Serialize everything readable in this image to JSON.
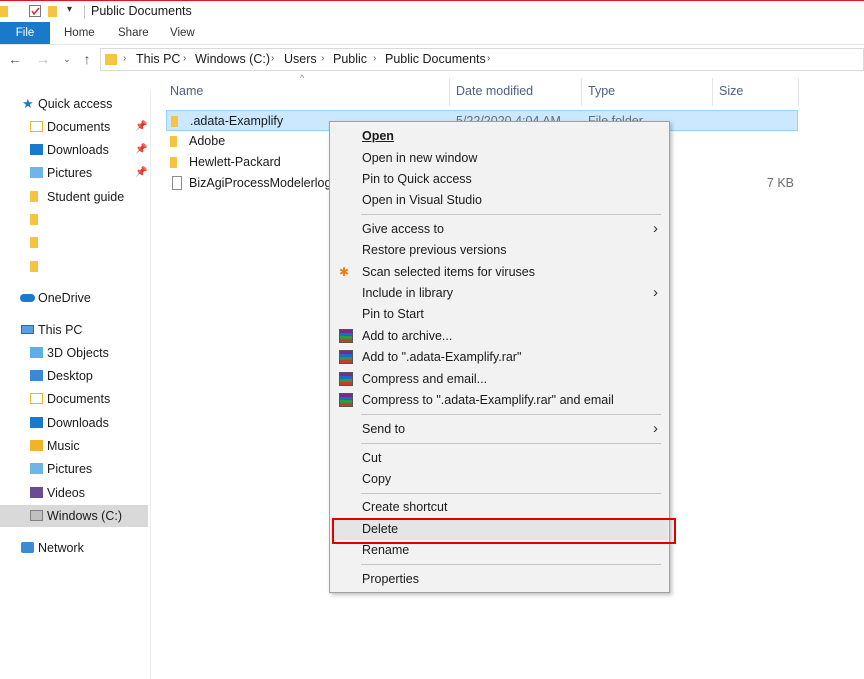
{
  "window": {
    "title": "Public Documents"
  },
  "ribbon": {
    "file": "File",
    "home": "Home",
    "share": "Share",
    "view": "View"
  },
  "breadcrumb": [
    "This PC",
    "Windows (C:)",
    "Users",
    "Public",
    "Public Documents"
  ],
  "sidebar": {
    "items": [
      {
        "label": "Quick access",
        "icon": "star-icon"
      },
      {
        "label": "Documents",
        "icon": "documents-icon",
        "pinned": true
      },
      {
        "label": "Downloads",
        "icon": "downloads-icon",
        "pinned": true
      },
      {
        "label": "Pictures",
        "icon": "pictures-icon",
        "pinned": true
      },
      {
        "label": "Student guide",
        "icon": "folder-icon"
      },
      {
        "label": "",
        "icon": "folder-icon"
      },
      {
        "label": "",
        "icon": "folder-icon"
      },
      {
        "label": "",
        "icon": "folder-icon"
      },
      {
        "label": "OneDrive",
        "icon": "cloud-icon"
      },
      {
        "label": "This PC",
        "icon": "computer-icon"
      },
      {
        "label": "3D Objects",
        "icon": "3d-objects-icon"
      },
      {
        "label": "Desktop",
        "icon": "desktop-icon"
      },
      {
        "label": "Documents",
        "icon": "documents-icon"
      },
      {
        "label": "Downloads",
        "icon": "downloads-icon"
      },
      {
        "label": "Music",
        "icon": "music-icon"
      },
      {
        "label": "Pictures",
        "icon": "pictures-icon"
      },
      {
        "label": "Videos",
        "icon": "videos-icon"
      },
      {
        "label": "Windows (C:)",
        "icon": "drive-icon",
        "selected": true
      },
      {
        "label": "Network",
        "icon": "network-icon"
      }
    ]
  },
  "columns": {
    "name": "Name",
    "date": "Date modified",
    "type": "Type",
    "size": "Size"
  },
  "files": [
    {
      "name": ".adata-Examplify",
      "date": "5/22/2020 4:04 AM",
      "type": "File folder",
      "size": "",
      "selected": true
    },
    {
      "name": "Adobe",
      "date": "",
      "type": "",
      "size": ""
    },
    {
      "name": "Hewlett-Packard",
      "date": "",
      "type": "",
      "size": ""
    },
    {
      "name": "BizAgiProcessModelerlog",
      "date": "",
      "type": "",
      "size": "7 KB"
    }
  ],
  "context_menu": {
    "open": "Open",
    "open_new_window": "Open in new window",
    "pin_quick_access": "Pin to Quick access",
    "open_visual_studio": "Open in Visual Studio",
    "give_access": "Give access to",
    "restore_versions": "Restore previous versions",
    "scan_viruses": "Scan selected items for viruses",
    "include_library": "Include in library",
    "pin_start": "Pin to Start",
    "add_archive": "Add to archive...",
    "add_rar": "Add to \".adata-Examplify.rar\"",
    "compress_email": "Compress and email...",
    "compress_rar_email": "Compress to \".adata-Examplify.rar\" and email",
    "send_to": "Send to",
    "cut": "Cut",
    "copy": "Copy",
    "create_shortcut": "Create shortcut",
    "delete": "Delete",
    "rename": "Rename",
    "properties": "Properties"
  },
  "colors": {
    "file_tab": "#1979ca",
    "selection": "#cce8ff",
    "highlight": "#e00000",
    "folder": "#f6c343"
  }
}
